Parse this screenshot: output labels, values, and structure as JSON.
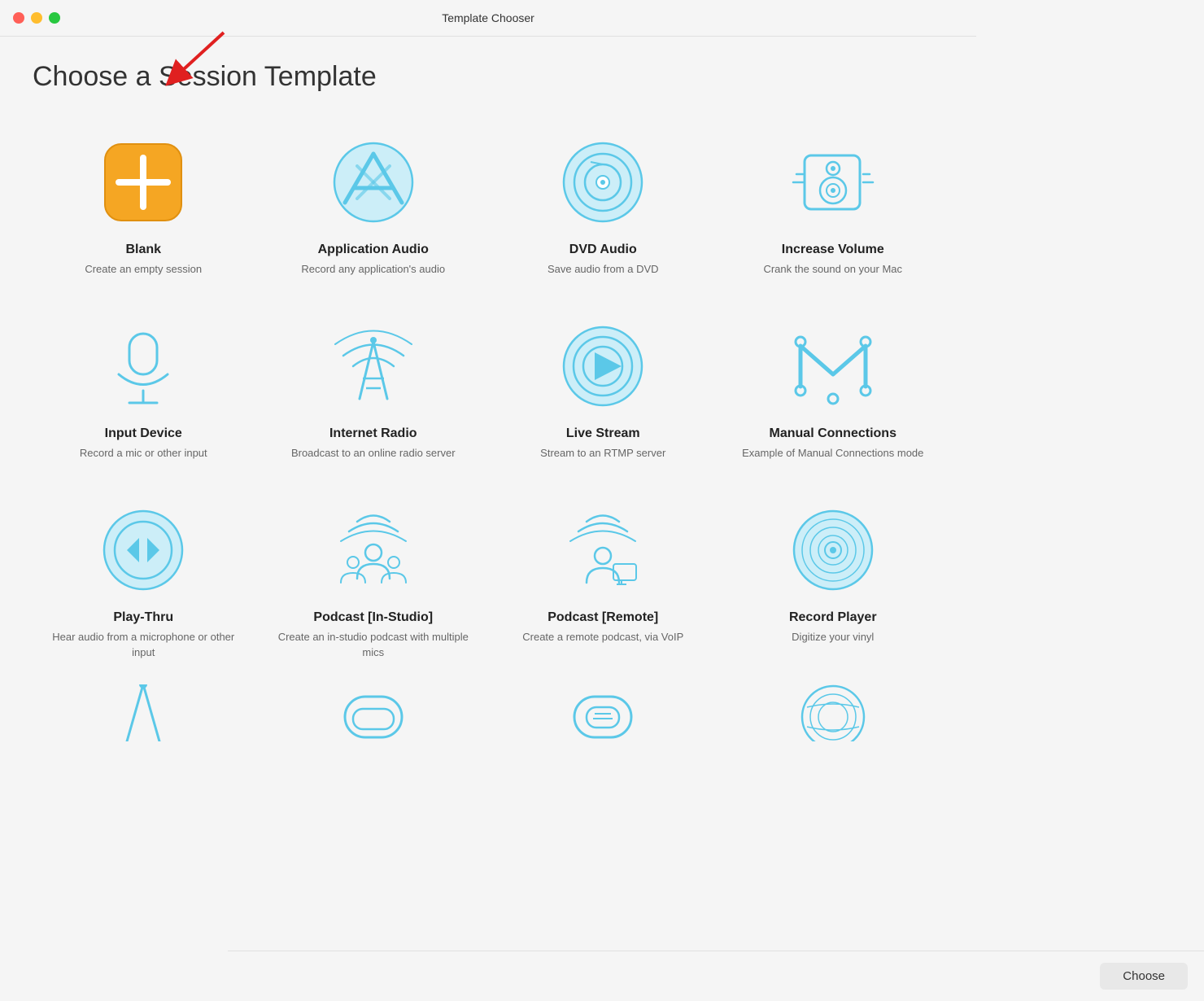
{
  "window": {
    "title": "Template Chooser"
  },
  "page": {
    "heading": "Choose a Session Template"
  },
  "controls": {
    "close": "close",
    "minimize": "minimize",
    "maximize": "maximize"
  },
  "templates": [
    {
      "id": "blank",
      "title": "Blank",
      "desc": "Create an empty session",
      "icon": "blank"
    },
    {
      "id": "application-audio",
      "title": "Application Audio",
      "desc": "Record any application's audio",
      "icon": "application-audio"
    },
    {
      "id": "dvd-audio",
      "title": "DVD Audio",
      "desc": "Save audio from a DVD",
      "icon": "dvd-audio"
    },
    {
      "id": "increase-volume",
      "title": "Increase Volume",
      "desc": "Crank the sound on your Mac",
      "icon": "increase-volume"
    },
    {
      "id": "input-device",
      "title": "Input Device",
      "desc": "Record a mic or other input",
      "icon": "input-device"
    },
    {
      "id": "internet-radio",
      "title": "Internet Radio",
      "desc": "Broadcast to an online radio server",
      "icon": "internet-radio"
    },
    {
      "id": "live-stream",
      "title": "Live Stream",
      "desc": "Stream to an RTMP server",
      "icon": "live-stream"
    },
    {
      "id": "manual-connections",
      "title": "Manual Connections",
      "desc": "Example of Manual Connections mode",
      "icon": "manual-connections"
    },
    {
      "id": "play-thru",
      "title": "Play-Thru",
      "desc": "Hear audio from a microphone or other input",
      "icon": "play-thru"
    },
    {
      "id": "podcast-in-studio",
      "title": "Podcast [In-Studio]",
      "desc": "Create an in-studio podcast with multiple mics",
      "icon": "podcast-in-studio"
    },
    {
      "id": "podcast-remote",
      "title": "Podcast [Remote]",
      "desc": "Create a remote podcast, via VoIP",
      "icon": "podcast-remote"
    },
    {
      "id": "record-player",
      "title": "Record Player",
      "desc": "Digitize your vinyl",
      "icon": "record-player"
    }
  ],
  "bottom": {
    "choose_label": "Choose"
  }
}
